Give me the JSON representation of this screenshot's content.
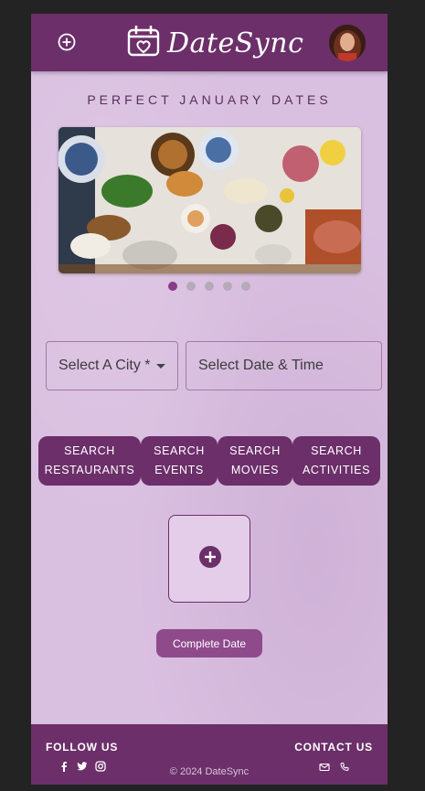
{
  "header": {
    "brand": "DateSync",
    "add_icon": "plus-circle-icon",
    "calendar_icon": "calendar-heart-icon",
    "avatar": "user-avatar"
  },
  "hero": {
    "tagline": "PERFECT JANUARY DATES",
    "carousel_image": "food-spread-photo",
    "slides": 5,
    "active_slide": 1
  },
  "filters": {
    "city_placeholder": "Select A City *",
    "date_placeholder": "Select Date & Time"
  },
  "search_buttons": [
    {
      "line1": "SEARCH",
      "line2": "RESTAURANTS"
    },
    {
      "line1": "SEARCH",
      "line2": "EVENTS"
    },
    {
      "line1": "SEARCH",
      "line2": "MOVIES"
    },
    {
      "line1": "SEARCH",
      "line2": "ACTIVITIES"
    }
  ],
  "builder": {
    "add_icon": "plus-circle-icon",
    "complete_label": "Complete Date"
  },
  "footer": {
    "follow_label": "FOLLOW US",
    "contact_label": "CONTACT US",
    "copyright": "© 2024 DateSync",
    "social_icons": [
      "facebook-icon",
      "twitter-icon",
      "instagram-icon"
    ],
    "contact_icons": [
      "mail-icon",
      "phone-icon"
    ]
  },
  "colors": {
    "primary": "#6c2f6a",
    "background": "#d9bfe0",
    "accent": "#8f4a8c"
  }
}
